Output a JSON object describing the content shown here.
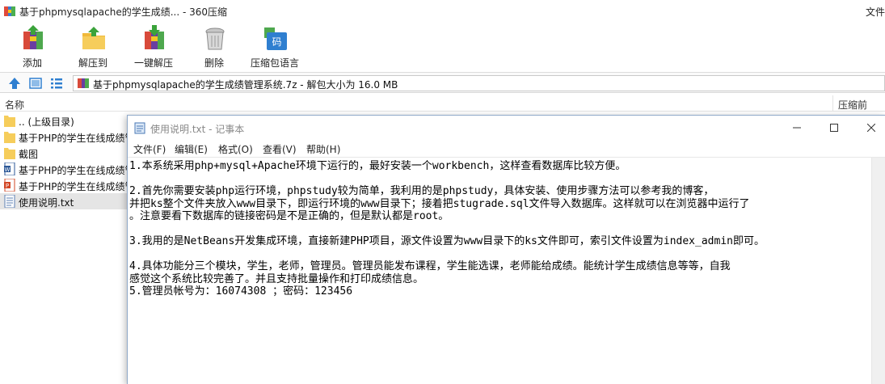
{
  "zip": {
    "title": "基于phpmysqlapache的学生成绩... - 360压缩",
    "title_right": "文件",
    "toolbar": [
      {
        "icon": "add-archive-icon",
        "label": "添加"
      },
      {
        "icon": "extract-to-icon",
        "label": "解压到"
      },
      {
        "icon": "one-click-extract-icon",
        "label": "一键解压"
      },
      {
        "icon": "delete-icon",
        "label": "删除"
      },
      {
        "icon": "compress-language-icon",
        "label": "压缩包语言"
      }
    ],
    "address": "基于phpmysqlapache的学生成绩管理系统.7z - 解包大小为 16.0 MB",
    "columns": {
      "name": "名称",
      "packed": "压缩前"
    },
    "files": [
      {
        "icon": "folder-icon",
        "name": ".. (上级目录)"
      },
      {
        "icon": "folder-icon",
        "name": "基于PHP的学生在线成绩管理系统"
      },
      {
        "icon": "folder-icon",
        "name": "截图"
      },
      {
        "icon": "word-doc-icon",
        "name": "基于PHP的学生在线成绩管理系统.doc"
      },
      {
        "icon": "ppt-icon",
        "name": "基于PHP的学生在线成绩管理系统.ppt"
      },
      {
        "icon": "text-file-icon",
        "name": "使用说明.txt"
      }
    ]
  },
  "notepad": {
    "title": "使用说明.txt - 记事本",
    "menu": [
      "文件(F)",
      "编辑(E)",
      "格式(O)",
      "查看(V)",
      "帮助(H)"
    ],
    "lines": [
      "1.本系统采用php+mysql+Apache环境下运行的，最好安装一个workbench，这样查看数据库比较方便。",
      "",
      "2.首先你需要安装php运行环境，phpstudy较为简单，我利用的是phpstudy，具体安装、使用步骤方法可以参考我的博客，",
      "并把ks整个文件夹放入www目录下，即运行环境的www目录下；接着把stugrade.sql文件导入数据库。这样就可以在浏览器中运行了",
      "。注意要看下数据库的链接密码是不是正确的，但是默认都是root。",
      "",
      "3.我用的是NetBeans开发集成环境，直接新建PHP项目，源文件设置为www目录下的ks文件即可，索引文件设置为index_admin即可。",
      "",
      "4.具体功能分三个模块，学生，老师，管理员。管理员能发布课程，学生能选课，老师能给成绩。能统计学生成绩信息等等，自我",
      "感觉这个系统比较完善了。并且支持批量操作和打印成绩信息。",
      "5.管理员帐号为：16074308 ；密码：123456"
    ]
  }
}
